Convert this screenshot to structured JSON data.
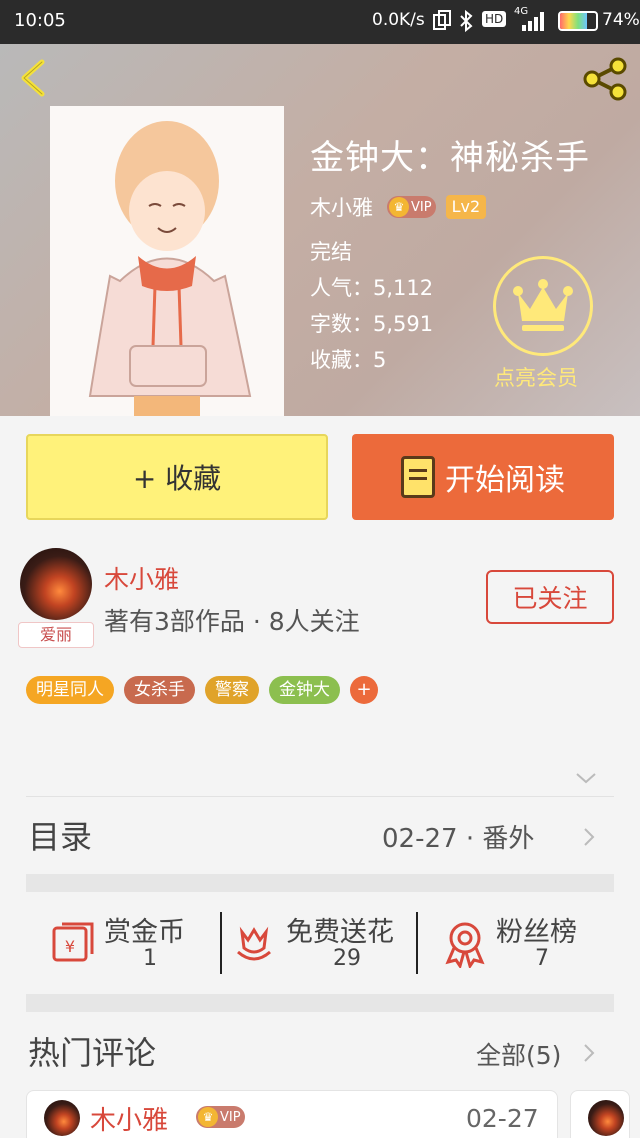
{
  "status_bar": {
    "time": "10:05",
    "net_speed": "0.0K/s",
    "hd": "HD",
    "network": "4G",
    "battery": "74%",
    "battery_level": 0.74
  },
  "book": {
    "title": "金钟大：神秘杀手",
    "author": "木小雅",
    "vip": "VIP",
    "level": "Lv2",
    "status": "完结",
    "popularity": "人气：5,112",
    "word_count": "字数：5,591",
    "favorites": "收藏：5",
    "member_label": "点亮会员"
  },
  "actions": {
    "collect": "+ 收藏",
    "read": "开始阅读"
  },
  "author_info": {
    "name": "木小雅",
    "works": "著有3部作品 · 8人关注",
    "avatar_tag": "爱丽",
    "follow": "已关注"
  },
  "tags": [
    {
      "label": "明星同人",
      "color": "#f5a623"
    },
    {
      "label": "女杀手",
      "color": "#c86a4e"
    },
    {
      "label": "警察",
      "color": "#e0a32a"
    },
    {
      "label": "金钟大",
      "color": "#8cbf4f"
    }
  ],
  "tag_add": "+",
  "catalog": {
    "label": "目录",
    "latest": "02-27 · 番外"
  },
  "stats": [
    {
      "label": "赏金币",
      "value": "1",
      "icon": "coin-envelope-icon"
    },
    {
      "label": "免费送花",
      "value": "29",
      "icon": "flower-icon"
    },
    {
      "label": "粉丝榜",
      "value": "7",
      "icon": "medal-icon"
    }
  ],
  "comments": {
    "title": "热门评论",
    "all": "全部(5)",
    "first": {
      "name": "木小雅",
      "vip": "VIP",
      "date": "02-27"
    }
  },
  "colors": {
    "accent": "#ec6a3b",
    "collect_bg": "#fff27a",
    "author_red": "#d8483b",
    "vip_gold": "#ffe97a"
  }
}
